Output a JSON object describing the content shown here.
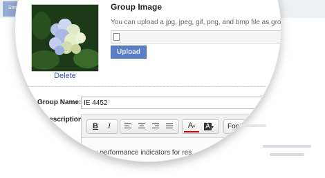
{
  "background": {
    "tab_label": "Step"
  },
  "group_image": {
    "title": "Group Image",
    "hint": "You can upload a jpg, jpeg, gif, png, and bmp file as group",
    "upload_label": "Upload",
    "delete_label": "Delete"
  },
  "form": {
    "group_name_label": "Group Name:",
    "group_name_value": "IE 4452",
    "description_label": "Description:",
    "editor_text": "key performance indicators for res"
  },
  "toolbar": {
    "bold": "B",
    "italic": "I",
    "font_color": "A",
    "highlight": "A",
    "font": "Font"
  },
  "colors": {
    "accent": "#5b7fc4",
    "link": "#2a56a8"
  }
}
